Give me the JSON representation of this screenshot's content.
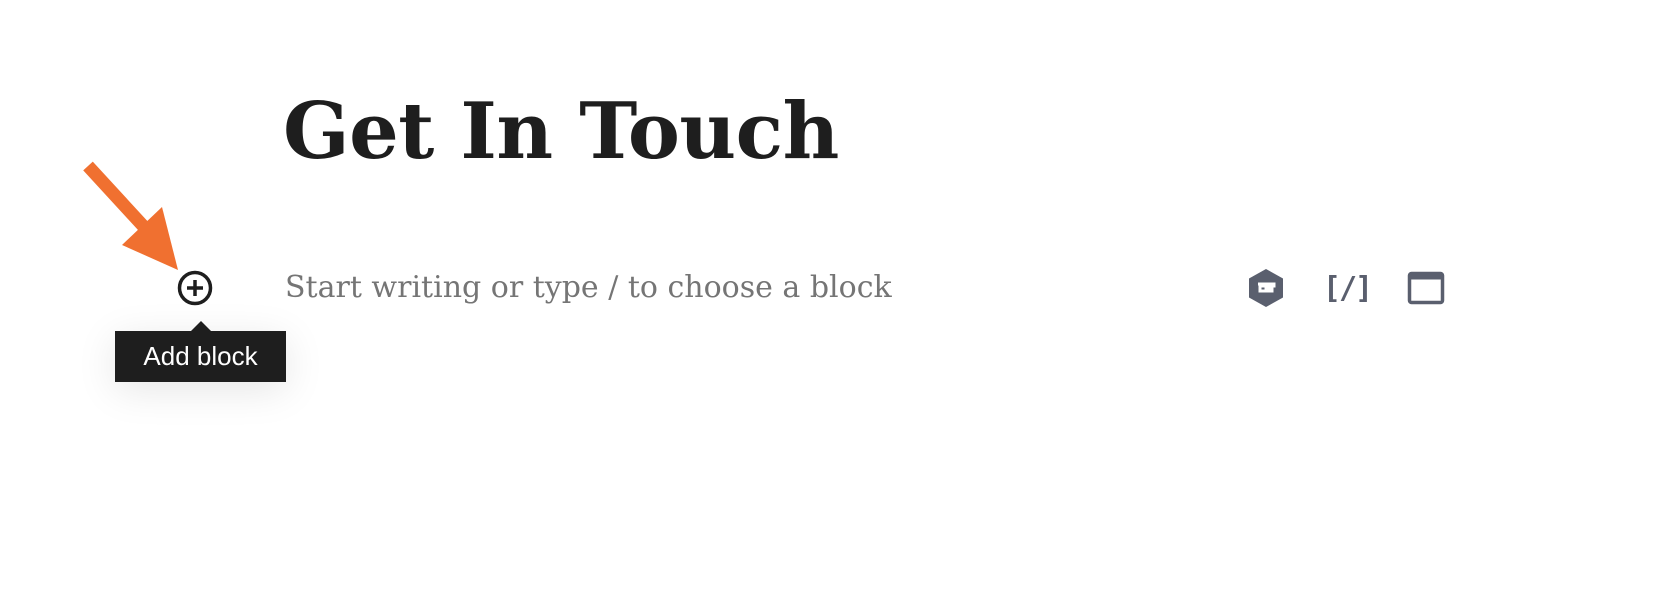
{
  "page": {
    "title": "Get In Touch",
    "placeholder": "Start writing or type / to choose a block"
  },
  "inserter": {
    "add_block_tooltip": "Add block",
    "add_block_icon": "plus-circle-icon"
  },
  "quick_inserters": [
    {
      "icon": "gravity-forms-icon"
    },
    {
      "icon": "shortcode-icon",
      "glyph": "[/]"
    },
    {
      "icon": "window-icon"
    }
  ],
  "annotation": {
    "arrow_color": "#f07030"
  },
  "colors": {
    "text": "#1e1e1e",
    "placeholder": "#757575",
    "icon": "#5a5f6e"
  }
}
